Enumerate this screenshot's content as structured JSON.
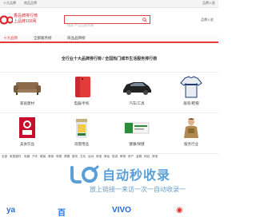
{
  "topbar": {
    "links": [
      "十大品牌",
      "商品品牌"
    ],
    "right_link": "品牌入驻"
  },
  "header": {
    "logo_text_line1": "香品牌排行榜",
    "logo_text_line2": "上品牌100网",
    "search_placeholder": "搜索 产品品牌名称",
    "right_link": "品牌入驻"
  },
  "nav": {
    "tabs": [
      "十大品牌",
      "全部服务榜",
      "商品品牌榜"
    ],
    "active_index": 0
  },
  "banner": {
    "title": "全行业十大品牌排行榜 / 全国热门城市生活服务排行榜",
    "subtitle": ""
  },
  "categories_grid": [
    {
      "label": "家居建材",
      "sub": "",
      "icon": "sofa-icon"
    },
    {
      "label": "电器/手机",
      "sub": "",
      "icon": "phone-icon"
    },
    {
      "label": "汽车/工具",
      "sub": "",
      "icon": "car-icon"
    },
    {
      "label": "服装/鞋帽",
      "sub": "",
      "icon": "tshirt-icon"
    },
    {
      "label": "美食饮品",
      "sub": "",
      "icon": "kfc-icon"
    },
    {
      "label": "母婴用品",
      "sub": "",
      "icon": "milk-can-icon"
    },
    {
      "label": "健康/保健",
      "sub": "",
      "icon": "medicine-box-icon"
    },
    {
      "label": "服务行业",
      "sub": "",
      "icon": "worker-icon"
    }
  ],
  "category_bar": [
    "全部",
    "家居建材",
    "电器",
    "汽车",
    "服装",
    "美食",
    "母婴",
    "健康",
    "服务",
    "文化",
    "运动",
    "珠宝",
    "美妆",
    "旅游",
    "教育",
    "房产",
    "金融",
    "网站",
    "其他"
  ],
  "watermark": {
    "title": "自动秒收录",
    "subtitle": "放上链接一来访一次一自动收录一"
  },
  "bottom_logos": [
    {
      "text": "ya",
      "color": "#2c6fd1"
    },
    {
      "text": "百",
      "color": "#1a73e8"
    },
    {
      "text": "VIVO",
      "color": "#2468d8"
    },
    {
      "text": "◉",
      "color": "#d33"
    }
  ],
  "colors": {
    "brand_red": "#e33a3a",
    "watermark_blue": "#5aa0d8"
  }
}
